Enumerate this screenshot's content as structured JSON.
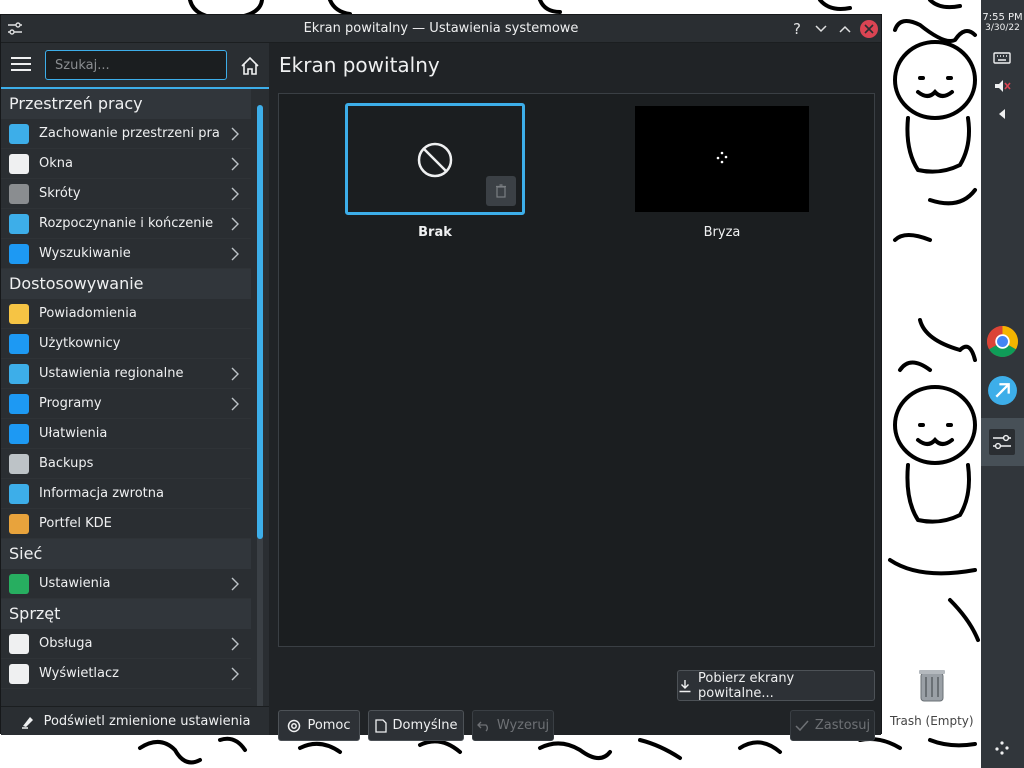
{
  "window": {
    "title": "Ekran powitalny — Ustawienia systemowe",
    "help_glyph": "?",
    "minimize_glyph": "⌄",
    "maximize_glyph": "⌃"
  },
  "sidebar": {
    "search_placeholder": "Szukaj...",
    "sections": [
      {
        "title": "Przestrzeń pracy",
        "items": [
          {
            "label": "Zachowanie przestrzeni pra...",
            "icon": "workspace-behavior-icon",
            "color": "#3daee9",
            "chevron": true
          },
          {
            "label": "Okna",
            "icon": "windows-icon",
            "color": "#eff0f1",
            "chevron": true
          },
          {
            "label": "Skróty",
            "icon": "keyboard-icon",
            "color": "#8a8d90",
            "chevron": true
          },
          {
            "label": "Rozpoczynanie i kończenie",
            "icon": "startup-shutdown-icon",
            "color": "#3daee9",
            "chevron": true
          },
          {
            "label": "Wyszukiwanie",
            "icon": "search-settings-icon",
            "color": "#1d99f3",
            "chevron": true
          }
        ]
      },
      {
        "title": "Dostosowywanie",
        "items": [
          {
            "label": "Powiadomienia",
            "icon": "bell-icon",
            "color": "#f6c444",
            "chevron": false
          },
          {
            "label": "Użytkownicy",
            "icon": "users-icon",
            "color": "#1d99f3",
            "chevron": false
          },
          {
            "label": "Ustawienia regionalne",
            "icon": "regional-icon",
            "color": "#3daee9",
            "chevron": true
          },
          {
            "label": "Programy",
            "icon": "applications-icon",
            "color": "#1d99f3",
            "chevron": true
          },
          {
            "label": "Ułatwienia",
            "icon": "accessibility-icon",
            "color": "#1d99f3",
            "chevron": false
          },
          {
            "label": "Backups",
            "icon": "backups-icon",
            "color": "#bdc3c7",
            "chevron": false
          },
          {
            "label": "Informacja zwrotna",
            "icon": "feedback-icon",
            "color": "#3daee9",
            "chevron": false
          },
          {
            "label": "Portfel KDE",
            "icon": "wallet-icon",
            "color": "#e8a33c",
            "chevron": false
          }
        ]
      },
      {
        "title": "Sieć",
        "items": [
          {
            "label": "Ustawienia",
            "icon": "network-globe-icon",
            "color": "#27ae60",
            "chevron": true
          }
        ]
      },
      {
        "title": "Sprzęt",
        "items": [
          {
            "label": "Obsługa",
            "icon": "input-devices-icon",
            "color": "#eff0f1",
            "chevron": true
          },
          {
            "label": "Wyświetlacz",
            "icon": "display-icon",
            "color": "#eff0f1",
            "chevron": true
          }
        ]
      }
    ],
    "highlight_button": "Podświetl zmienione ustawienia"
  },
  "main": {
    "title": "Ekran powitalny",
    "splash_items": [
      {
        "label": "Brak",
        "selected": true
      },
      {
        "label": "Bryza",
        "selected": false
      }
    ],
    "get_new_button": "Pobierz ekrany powitalne...",
    "help_button": "Pomoc",
    "defaults_button": "Domyślne",
    "reset_button": "Wyzeruj",
    "apply_button": "Zastosuj"
  },
  "panel": {
    "time": "7:55 PM",
    "date": "3/30/22"
  },
  "desktop": {
    "trash_label": "Trash (Empty)"
  },
  "colors": {
    "accent": "#3daee9",
    "window_bg": "#202326",
    "sidebar_bg": "#2a2e32",
    "close": "#da4453"
  }
}
